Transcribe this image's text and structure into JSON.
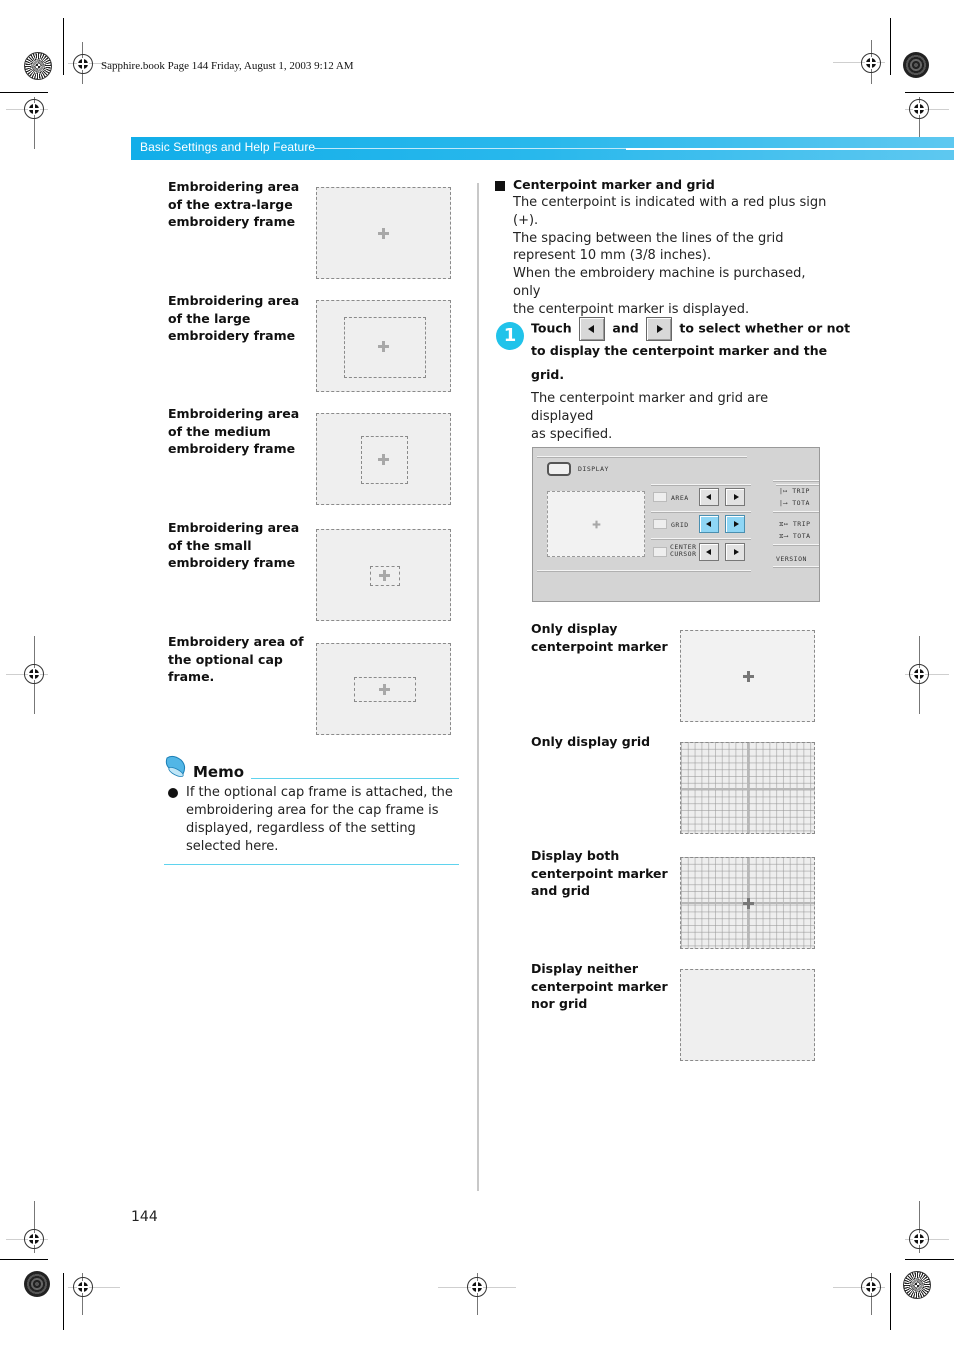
{
  "slug": "Sapphire.book  Page 144  Friday, August 1, 2003  9:12 AM",
  "header": {
    "section_title": "Basic Settings and Help Feature"
  },
  "left_column": {
    "frames": [
      {
        "label": "Embroidering area of the extra-large embroidery frame",
        "lines": [
          "Embroidering area",
          "of the extra-large",
          "embroidery frame"
        ]
      },
      {
        "label": "Embroidering area of the large embroidery frame",
        "lines": [
          "Embroidering area",
          "of the large",
          "embroidery frame"
        ]
      },
      {
        "label": "Embroidering area of the medium embroidery frame",
        "lines": [
          "Embroidering area",
          "of the medium",
          "embroidery frame"
        ]
      },
      {
        "label": "Embroidering area of the small embroidery frame",
        "lines": [
          "Embroidering area",
          "of the small",
          "embroidery frame"
        ]
      },
      {
        "label": "Embroidery area of the optional cap frame.",
        "lines": [
          "Embroidery area of",
          "the optional cap",
          "frame."
        ]
      }
    ],
    "memo": {
      "title": "Memo",
      "bullets": [
        "If the optional cap frame is attached, the embroidering area for the cap frame is displayed, regardless of the setting selected here."
      ]
    }
  },
  "right_column": {
    "section_heading": "Centerpoint marker and grid",
    "intro_lines": [
      "The centerpoint is indicated with a red plus sign",
      "(+).",
      "The spacing between the lines of the grid",
      "represent 10 mm (3/8 inches).",
      "When the embroidery machine is purchased, only",
      "the centerpoint marker is displayed."
    ],
    "step": {
      "number": "1",
      "touch": "Touch",
      "and": "and",
      "line1_end": "to select whether or not",
      "line2": "to display the centerpoint marker and the",
      "line3": "grid.",
      "result_lines": [
        "The centerpoint marker and grid are displayed",
        "as specified."
      ]
    },
    "screen": {
      "title": "DISPLAY",
      "rows": [
        {
          "label": "AREA",
          "active": false
        },
        {
          "label": "GRID",
          "active": true
        },
        {
          "label": "CENTER\nCURSOR",
          "label_lines": [
            "CENTER",
            "CURSOR"
          ],
          "active": false
        }
      ],
      "right_items": [
        "TRIP",
        "TOTA",
        "TRIP",
        "TOTA",
        "VERSION"
      ]
    },
    "options": [
      {
        "lines": [
          "Only display",
          "centerpoint marker"
        ],
        "grid": false,
        "marker": true
      },
      {
        "lines": [
          "Only display grid"
        ],
        "grid": true,
        "marker": false
      },
      {
        "lines": [
          "Display both",
          "centerpoint marker",
          "and grid"
        ],
        "grid": true,
        "marker": true
      },
      {
        "lines": [
          "Display neither",
          "centerpoint marker",
          "nor grid"
        ],
        "grid": false,
        "marker": false
      }
    ]
  },
  "footer": {
    "page_number": "144"
  }
}
